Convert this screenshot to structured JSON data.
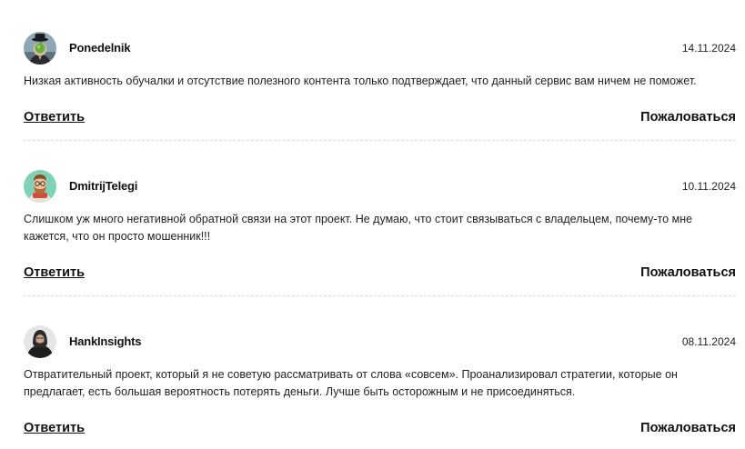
{
  "comments": [
    {
      "username": "Ponedelnik",
      "date": "14.11.2024",
      "text": "Низкая активность обучалки и отсутствие полезного контента только подтверждает, что данный сервис вам ничем не поможет.",
      "reply_label": "Ответить",
      "report_label": "Пожаловаться",
      "avatar": "apple-face-painting-avatar"
    },
    {
      "username": "DmitrijTelegi",
      "date": "10.11.2024",
      "text": "Слишком уж много негативной обратной связи на этот проект. Не думаю, что стоит связываться с владельцем, почему-то мне кажется, что он просто мошенник!!!",
      "reply_label": "Ответить",
      "report_label": "Пожаловаться",
      "avatar": "bearded-man-cartoon-avatar"
    },
    {
      "username": "HankInsights",
      "date": "08.11.2024",
      "text": "Отвратительный проект, который я не советую рассматривать от слова «совсем». Проанализировал стратегии, которые он предлагает, есть большая вероятность потерять деньги. Лучше быть осторожным и не присоединяться.",
      "reply_label": "Ответить",
      "report_label": "Пожаловаться",
      "avatar": "man-in-hoodie-photo-avatar"
    }
  ]
}
